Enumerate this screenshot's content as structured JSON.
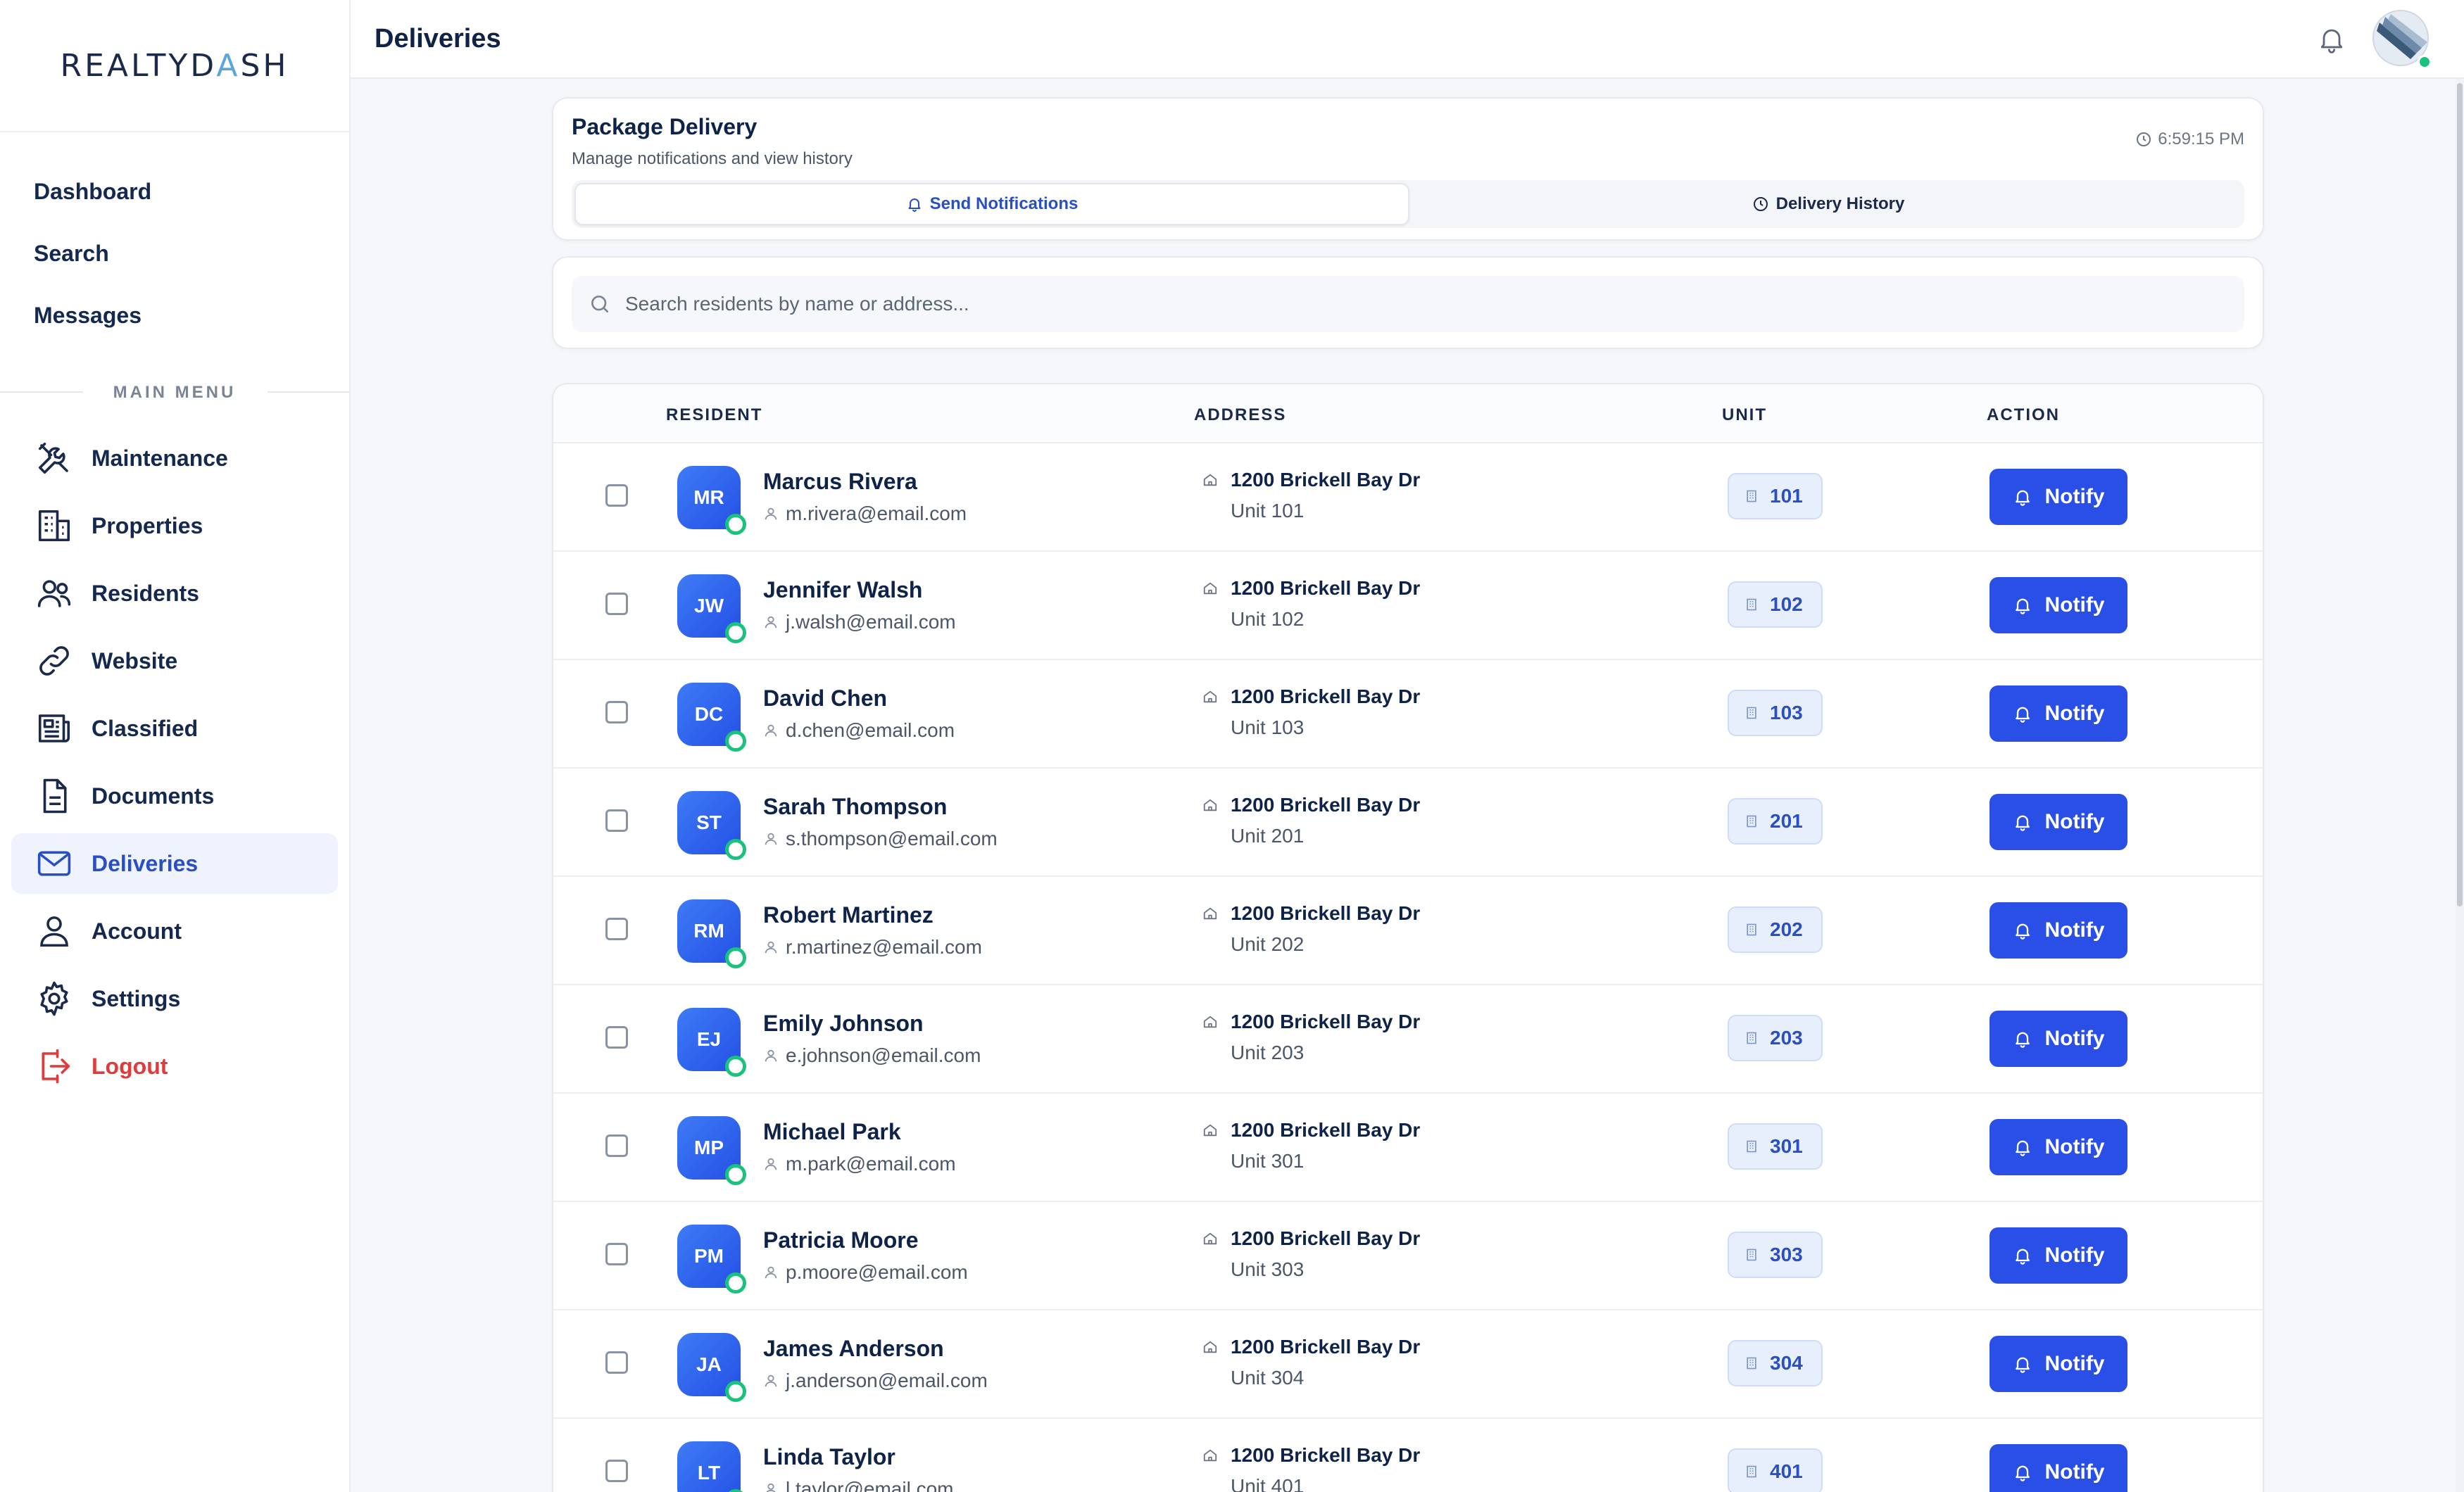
{
  "brand": {
    "name_part1": "REALTYD",
    "name_accent": "A",
    "name_part2": "SH"
  },
  "sidebar": {
    "quick": [
      {
        "label": "Dashboard",
        "key": "dashboard"
      },
      {
        "label": "Search",
        "key": "search"
      },
      {
        "label": "Messages",
        "key": "messages"
      }
    ],
    "section_label": "MAIN MENU",
    "items": [
      {
        "label": "Maintenance",
        "icon": "tools-icon",
        "key": "maintenance"
      },
      {
        "label": "Properties",
        "icon": "building-icon",
        "key": "properties"
      },
      {
        "label": "Residents",
        "icon": "users-icon",
        "key": "residents"
      },
      {
        "label": "Website",
        "icon": "link-icon",
        "key": "website"
      },
      {
        "label": "Classified",
        "icon": "newspaper-icon",
        "key": "classified"
      },
      {
        "label": "Documents",
        "icon": "document-icon",
        "key": "documents"
      },
      {
        "label": "Deliveries",
        "icon": "mail-icon",
        "key": "deliveries",
        "active": true
      },
      {
        "label": "Account",
        "icon": "user-icon",
        "key": "account"
      },
      {
        "label": "Settings",
        "icon": "gear-icon",
        "key": "settings"
      },
      {
        "label": "Logout",
        "icon": "logout-icon",
        "key": "logout"
      }
    ]
  },
  "header": {
    "title": "Deliveries"
  },
  "package": {
    "title": "Package Delivery",
    "subtitle": "Manage notifications and view history",
    "time": "6:59:15 PM",
    "tabs": [
      {
        "label": "Send Notifications",
        "active": true
      },
      {
        "label": "Delivery History",
        "active": false
      }
    ]
  },
  "search": {
    "placeholder": "Search residents by name or address..."
  },
  "table": {
    "columns": [
      "RESIDENT",
      "ADDRESS",
      "UNIT",
      "ACTION"
    ],
    "action_label": "Notify",
    "rows": [
      {
        "initials": "MR",
        "name": "Marcus Rivera",
        "email": "m.rivera@email.com",
        "street": "1200 Brickell Bay Dr",
        "unit_line": "Unit 101",
        "unit": "101"
      },
      {
        "initials": "JW",
        "name": "Jennifer Walsh",
        "email": "j.walsh@email.com",
        "street": "1200 Brickell Bay Dr",
        "unit_line": "Unit 102",
        "unit": "102"
      },
      {
        "initials": "DC",
        "name": "David Chen",
        "email": "d.chen@email.com",
        "street": "1200 Brickell Bay Dr",
        "unit_line": "Unit 103",
        "unit": "103"
      },
      {
        "initials": "ST",
        "name": "Sarah Thompson",
        "email": "s.thompson@email.com",
        "street": "1200 Brickell Bay Dr",
        "unit_line": "Unit 201",
        "unit": "201"
      },
      {
        "initials": "RM",
        "name": "Robert Martinez",
        "email": "r.martinez@email.com",
        "street": "1200 Brickell Bay Dr",
        "unit_line": "Unit 202",
        "unit": "202"
      },
      {
        "initials": "EJ",
        "name": "Emily Johnson",
        "email": "e.johnson@email.com",
        "street": "1200 Brickell Bay Dr",
        "unit_line": "Unit 203",
        "unit": "203"
      },
      {
        "initials": "MP",
        "name": "Michael Park",
        "email": "m.park@email.com",
        "street": "1200 Brickell Bay Dr",
        "unit_line": "Unit 301",
        "unit": "301"
      },
      {
        "initials": "PM",
        "name": "Patricia Moore",
        "email": "p.moore@email.com",
        "street": "1200 Brickell Bay Dr",
        "unit_line": "Unit 303",
        "unit": "303"
      },
      {
        "initials": "JA",
        "name": "James Anderson",
        "email": "j.anderson@email.com",
        "street": "1200 Brickell Bay Dr",
        "unit_line": "Unit 304",
        "unit": "304"
      },
      {
        "initials": "LT",
        "name": "Linda Taylor",
        "email": "l.taylor@email.com",
        "street": "1200 Brickell Bay Dr",
        "unit_line": "Unit 401",
        "unit": "401"
      }
    ]
  },
  "colors": {
    "primary": "#2a4fe6",
    "accent": "#5aa6d8",
    "danger": "#e03a3a",
    "online": "#19c37d"
  }
}
